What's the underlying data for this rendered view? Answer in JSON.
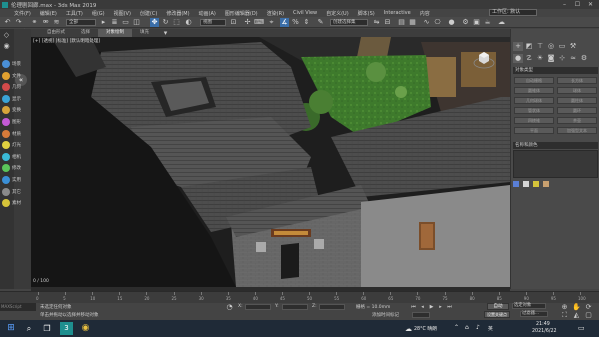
{
  "window": {
    "title": "伦理剧回廊.max - 3ds Max 2019",
    "controls": [
      "–",
      "☐",
      "✕"
    ]
  },
  "menu": {
    "items": [
      "文件(F)",
      "编辑(E)",
      "工具(T)",
      "组(G)",
      "视图(V)",
      "创建(C)",
      "修改器(M)",
      "动画(A)",
      "图形编辑器(D)",
      "渲染(R)",
      "Civil View",
      "自定义(U)",
      "脚本(S)",
      "Interactive",
      "内容"
    ],
    "workspace_label": "工作区: 默认"
  },
  "toolbar": {
    "selection_filter": "全部",
    "ref_coord": "视图",
    "named_selection": "创建选择集"
  },
  "ribbon": {
    "tabs": [
      "建模",
      "自由形式",
      "选择",
      "对象绘制",
      "填充"
    ],
    "active_index": 3
  },
  "leftbar": {
    "items": [
      {
        "label": "场景",
        "color": "#4a8fd6"
      },
      {
        "label": "文件",
        "color": "#e0a030"
      },
      {
        "label": "几何",
        "color": "#d24a4a"
      },
      {
        "label": "显示",
        "color": "#3aa3d6"
      },
      {
        "label": "变换",
        "color": "#d6a43a"
      },
      {
        "label": "图形",
        "color": "#c45ad6"
      },
      {
        "label": "材质",
        "color": "#d67a3a"
      },
      {
        "label": "灯光",
        "color": "#e0d040"
      },
      {
        "label": "相机",
        "color": "#3ab9d6"
      },
      {
        "label": "修改",
        "color": "#5ac45a"
      },
      {
        "label": "实用",
        "color": "#3a8fd6"
      },
      {
        "label": "其它",
        "color": "#8a8a8a"
      },
      {
        "label": "素材",
        "color": "#d6c43a"
      }
    ]
  },
  "viewport": {
    "label": "[+] [透视] [标准] [默认明暗处理]",
    "frame_counter": "0 / 100"
  },
  "command_panel": {
    "section_title": "对象类型",
    "buttons": [
      "自动栅格",
      "长方体",
      "圆锥体",
      "球体",
      "几何球体",
      "圆柱体",
      "管状体",
      "圆环",
      "四棱锥",
      "茶壶",
      "平面",
      "加强型文本"
    ],
    "section2": "名称和颜色"
  },
  "timeline": {
    "ticks": [
      "0",
      "5",
      "10",
      "15",
      "20",
      "25",
      "30",
      "35",
      "40",
      "45",
      "50",
      "55",
      "60",
      "65",
      "70",
      "75",
      "80",
      "85",
      "90",
      "95",
      "100"
    ]
  },
  "status": {
    "maxscript_label": "MAXScript",
    "line1": "未选定任何对象",
    "line2": "单击并拖动以选择并移动对象",
    "x_label": "X:",
    "y_label": "Y:",
    "z_label": "Z:",
    "grid": "栅格 = 10.0mm",
    "add_time_tag": "添加时间标记",
    "auto_key": "自动",
    "set_key": "设置关键点",
    "selected": "选定对象",
    "key_filters": "过滤器..."
  },
  "taskbar": {
    "weather": "28°C 晴朗",
    "ime": "英",
    "time": "21:49",
    "date": "2021/6/22"
  }
}
